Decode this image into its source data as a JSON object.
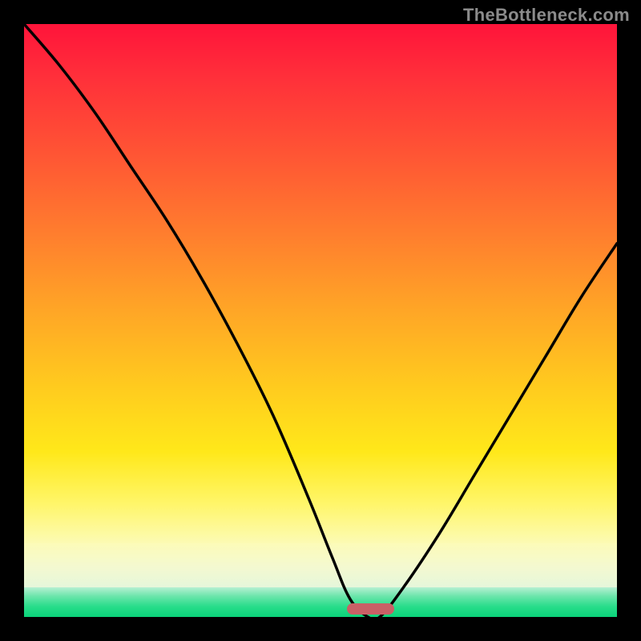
{
  "watermark": "TheBottleneck.com",
  "chart_data": {
    "type": "line",
    "title": "",
    "xlabel": "",
    "ylabel": "",
    "xlim": [
      0,
      100
    ],
    "ylim": [
      0,
      100
    ],
    "grid": false,
    "legend": false,
    "series": [
      {
        "name": "bottleneck-curve",
        "x": [
          0,
          6,
          12,
          18,
          24,
          30,
          36,
          42,
          48,
          52,
          55,
          58,
          60,
          64,
          70,
          76,
          82,
          88,
          94,
          100
        ],
        "y": [
          100,
          93,
          85,
          76,
          67,
          57,
          46,
          34,
          20,
          10,
          3,
          0,
          0,
          5,
          14,
          24,
          34,
          44,
          54,
          63
        ]
      }
    ],
    "optimal_range_x": [
      55,
      62
    ],
    "marker": {
      "x_center": 58.5,
      "width_pct": 8
    },
    "background_gradient_stops": [
      {
        "pct": 0,
        "color": "#ff143a"
      },
      {
        "pct": 55,
        "color": "#ffa626"
      },
      {
        "pct": 82,
        "color": "#ffe81a"
      },
      {
        "pct": 95,
        "color": "#e3f6dc"
      },
      {
        "pct": 100,
        "color": "#0ad37a"
      }
    ]
  },
  "marker_style": {
    "color": "#c96066"
  }
}
